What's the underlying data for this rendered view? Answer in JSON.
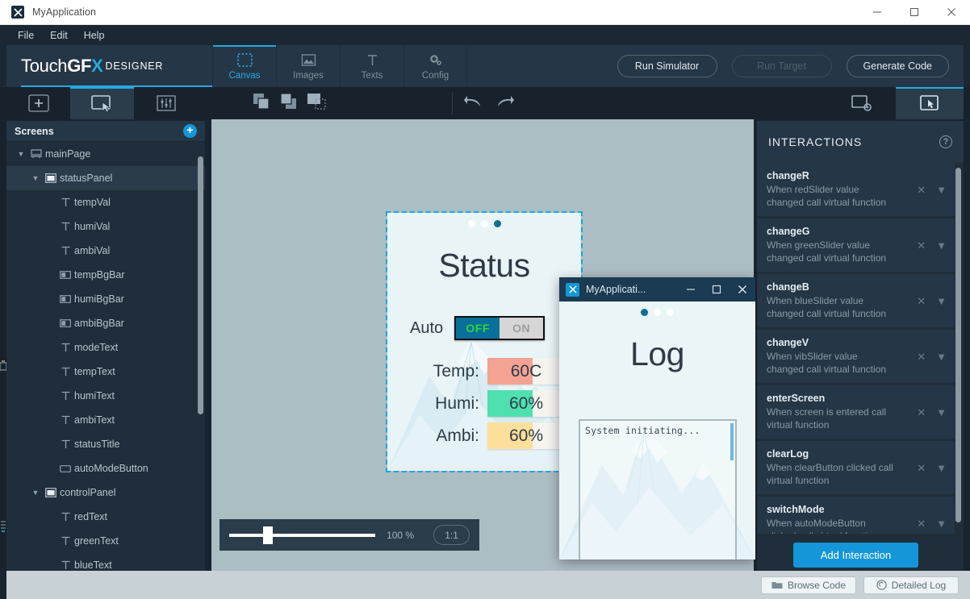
{
  "window": {
    "title": "MyApplication",
    "icon": "app-icon",
    "controls": {
      "minimize": "minimize-icon",
      "maximize": "maximize-icon",
      "close": "close-icon"
    }
  },
  "menubar": {
    "items": [
      "File",
      "Edit",
      "Help"
    ]
  },
  "brand": {
    "part1": "Touch",
    "part2": "GF",
    "part3": "X",
    "sub": "DESIGNER"
  },
  "header": {
    "tabs": [
      {
        "label": "Canvas",
        "icon": "canvas-icon",
        "active": true
      },
      {
        "label": "Images",
        "icon": "images-icon",
        "active": false
      },
      {
        "label": "Texts",
        "icon": "texts-icon",
        "active": false
      },
      {
        "label": "Config",
        "icon": "config-icon",
        "active": false
      }
    ],
    "actions": [
      {
        "label": "Run Simulator",
        "disabled": false
      },
      {
        "label": "Run Target",
        "disabled": true
      },
      {
        "label": "Generate Code",
        "disabled": false
      }
    ]
  },
  "toolstrip": {
    "left": [
      {
        "icon": "add-widget-icon",
        "active": false
      },
      {
        "icon": "select-cursor-icon",
        "active": true
      },
      {
        "icon": "sliders-icon",
        "active": false
      }
    ],
    "group": [
      {
        "icon": "bring-to-front-icon"
      },
      {
        "icon": "send-to-back-icon"
      },
      {
        "icon": "align-icon"
      }
    ],
    "history": [
      {
        "icon": "undo-icon"
      },
      {
        "icon": "redo-icon"
      }
    ],
    "right": [
      {
        "icon": "screen-settings-icon",
        "active": false
      },
      {
        "icon": "interactions-icon",
        "active": true
      }
    ]
  },
  "sidebar": {
    "title": "Screens",
    "add_icon": "plus-circle-icon",
    "items": [
      {
        "label": "mainPage",
        "icon": "screen-icon",
        "indent": 0,
        "chevron": "v",
        "selected": false
      },
      {
        "label": "statusPanel",
        "icon": "container-icon",
        "indent": 1,
        "chevron": "v",
        "selected": true
      },
      {
        "label": "tempVal",
        "icon": "text-icon",
        "indent": 2,
        "chevron": "",
        "selected": false
      },
      {
        "label": "humiVal",
        "icon": "text-icon",
        "indent": 2,
        "chevron": "",
        "selected": false
      },
      {
        "label": "ambiVal",
        "icon": "text-icon",
        "indent": 2,
        "chevron": "",
        "selected": false
      },
      {
        "label": "tempBgBar",
        "icon": "box-icon",
        "indent": 2,
        "chevron": "",
        "selected": false
      },
      {
        "label": "humiBgBar",
        "icon": "box-icon",
        "indent": 2,
        "chevron": "",
        "selected": false
      },
      {
        "label": "ambiBgBar",
        "icon": "box-icon",
        "indent": 2,
        "chevron": "",
        "selected": false
      },
      {
        "label": "modeText",
        "icon": "text-icon",
        "indent": 2,
        "chevron": "",
        "selected": false
      },
      {
        "label": "tempText",
        "icon": "text-icon",
        "indent": 2,
        "chevron": "",
        "selected": false
      },
      {
        "label": "humiText",
        "icon": "text-icon",
        "indent": 2,
        "chevron": "",
        "selected": false
      },
      {
        "label": "ambiText",
        "icon": "text-icon",
        "indent": 2,
        "chevron": "",
        "selected": false
      },
      {
        "label": "statusTitle",
        "icon": "text-icon",
        "indent": 2,
        "chevron": "",
        "selected": false
      },
      {
        "label": "autoModeButton",
        "icon": "button-icon",
        "indent": 2,
        "chevron": "",
        "selected": false
      },
      {
        "label": "controlPanel",
        "icon": "container-icon",
        "indent": 1,
        "chevron": "v",
        "selected": false
      },
      {
        "label": "redText",
        "icon": "text-icon",
        "indent": 2,
        "chevron": "",
        "selected": false
      },
      {
        "label": "greenText",
        "icon": "text-icon",
        "indent": 2,
        "chevron": "",
        "selected": false
      },
      {
        "label": "blueText",
        "icon": "text-icon",
        "indent": 2,
        "chevron": "",
        "selected": false
      }
    ]
  },
  "canvas": {
    "background_color": "#adbdc4",
    "device": {
      "title": "Status",
      "dots": [
        false,
        false,
        true
      ],
      "auto_label": "Auto",
      "toggle": {
        "off_label": "OFF",
        "on_label": "ON",
        "state": "OFF"
      },
      "rows": [
        {
          "label": "Temp:",
          "value": "60C",
          "fill_color": "#f4a393",
          "fill_pct": 58
        },
        {
          "label": "Humi:",
          "value": "60%",
          "fill_color": "#4fe0b0",
          "fill_pct": 58
        },
        {
          "label": "Ambi:",
          "value": "60%",
          "fill_color": "#fbdf9a",
          "fill_pct": 58
        }
      ]
    },
    "zoom": {
      "percent": "100 %",
      "ratio": "1:1",
      "slider_value": 22
    }
  },
  "simulator": {
    "title": "MyApplicati...",
    "icon": "app-icon",
    "controls": {
      "minimize": "minimize-icon",
      "maximize": "maximize-icon",
      "close": "close-icon"
    },
    "screen_title": "Log",
    "dots": [
      true,
      false,
      false
    ],
    "log_text": "System initiating..."
  },
  "interactions": {
    "title": "INTERACTIONS",
    "help_icon": "help-icon",
    "add_label": "Add Interaction",
    "items": [
      {
        "name": "changeR",
        "desc": "When redSlider value changed call virtual function"
      },
      {
        "name": "changeG",
        "desc": "When greenSlider value changed call virtual function"
      },
      {
        "name": "changeB",
        "desc": "When blueSlider value changed call virtual function"
      },
      {
        "name": "changeV",
        "desc": "When vibSlider value changed call virtual function"
      },
      {
        "name": "enterScreen",
        "desc": "When screen is entered call virtual function"
      },
      {
        "name": "clearLog",
        "desc": "When clearButton clicked call virtual function"
      },
      {
        "name": "switchMode",
        "desc": "When autoModeButton clicked call virtual function"
      }
    ],
    "row_actions": {
      "remove": "close-icon",
      "expand": "chevron-down-icon"
    }
  },
  "statusbar": {
    "buttons": [
      {
        "label": "Browse Code",
        "icon": "folder-icon"
      },
      {
        "label": "Detailed Log",
        "icon": "log-icon"
      }
    ]
  },
  "colors": {
    "accent": "#28a8e0",
    "panel": "#1f2e3a",
    "panel_header": "#253646",
    "chrome": "#1b2834",
    "canvas_bg": "#adbdc4"
  }
}
